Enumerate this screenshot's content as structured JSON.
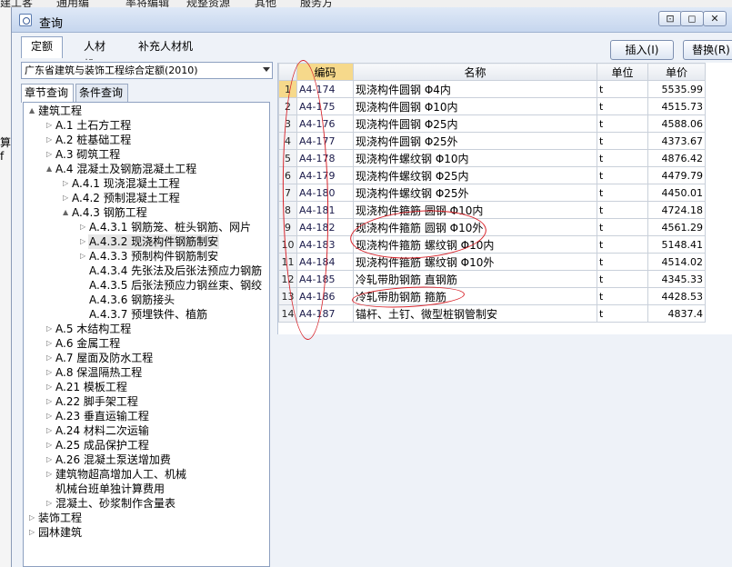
{
  "background_app": {
    "menu_items": [
      "建工客",
      "通用编",
      "率将编辑",
      "规整资源",
      "其他",
      "服务方"
    ],
    "left_text": "算f"
  },
  "dialog": {
    "title": "查询",
    "window_buttons": [
      "⊡",
      "◻",
      "✕"
    ],
    "top_tabs": [
      {
        "label": "定额",
        "active": true
      },
      {
        "label": "人材机",
        "active": false
      },
      {
        "label": "补充人材机",
        "active": false
      }
    ],
    "insert_button": "插入(I)",
    "replace_button": "替换(R)"
  },
  "left_panel": {
    "quota_library": "广东省建筑与装饰工程综合定额(2010)",
    "sub_tabs": [
      {
        "label": "章节查询",
        "active": true
      },
      {
        "label": "条件查询",
        "active": false
      }
    ],
    "tree": [
      {
        "label": "建筑工程",
        "level": 0,
        "toggle": "▲"
      },
      {
        "label": "A.1 土石方工程",
        "level": 1,
        "toggle": "▷"
      },
      {
        "label": "A.2 桩基础工程",
        "level": 1,
        "toggle": "▷"
      },
      {
        "label": "A.3 砌筑工程",
        "level": 1,
        "toggle": "▷"
      },
      {
        "label": "A.4 混凝土及钢筋混凝土工程",
        "level": 1,
        "toggle": "▲"
      },
      {
        "label": "A.4.1 现浇混凝土工程",
        "level": 2,
        "toggle": "▷"
      },
      {
        "label": "A.4.2 预制混凝土工程",
        "level": 2,
        "toggle": "▷"
      },
      {
        "label": "A.4.3 钢筋工程",
        "level": 2,
        "toggle": "▲"
      },
      {
        "label": "A.4.3.1 钢筋笼、桩头钢筋、网片",
        "level": 3,
        "toggle": "▷"
      },
      {
        "label": "A.4.3.2 现浇构件钢筋制安",
        "level": 3,
        "toggle": "▷",
        "selected": true
      },
      {
        "label": "A.4.3.3 预制构件钢筋制安",
        "level": 3,
        "toggle": "▷"
      },
      {
        "label": "A.4.3.4 先张法及后张法预应力钢筋",
        "level": 3,
        "toggle": ""
      },
      {
        "label": "A.4.3.5 后张法预应力钢丝束、钢绞",
        "level": 3,
        "toggle": ""
      },
      {
        "label": "A.4.3.6 钢筋接头",
        "level": 3,
        "toggle": ""
      },
      {
        "label": "A.4.3.7 预埋铁件、植筋",
        "level": 3,
        "toggle": ""
      },
      {
        "label": "A.5 木结构工程",
        "level": 1,
        "toggle": "▷"
      },
      {
        "label": "A.6 金属工程",
        "level": 1,
        "toggle": "▷"
      },
      {
        "label": "A.7 屋面及防水工程",
        "level": 1,
        "toggle": "▷"
      },
      {
        "label": "A.8 保温隔热工程",
        "level": 1,
        "toggle": "▷"
      },
      {
        "label": "A.21 模板工程",
        "level": 1,
        "toggle": "▷"
      },
      {
        "label": "A.22 脚手架工程",
        "level": 1,
        "toggle": "▷"
      },
      {
        "label": "A.23 垂直运输工程",
        "level": 1,
        "toggle": "▷"
      },
      {
        "label": "A.24 材料二次运输",
        "level": 1,
        "toggle": "▷"
      },
      {
        "label": "A.25 成品保护工程",
        "level": 1,
        "toggle": "▷"
      },
      {
        "label": "A.26 混凝土泵送增加费",
        "level": 1,
        "toggle": "▷"
      },
      {
        "label": "建筑物超高增加人工、机械",
        "level": 1,
        "toggle": "▷"
      },
      {
        "label": "机械台班单独计算费用",
        "level": 1,
        "toggle": ""
      },
      {
        "label": "混凝土、砂浆制作含量表",
        "level": 1,
        "toggle": "▷"
      },
      {
        "label": "装饰工程",
        "level": 0,
        "toggle": "▷"
      },
      {
        "label": "园林建筑",
        "level": 0,
        "toggle": "▷"
      }
    ]
  },
  "grid": {
    "columns": [
      "",
      "编码",
      "名称",
      "单位",
      "单价"
    ],
    "rows": [
      {
        "num": "1",
        "code": "A4-174",
        "name": "现浇构件圆钢 Φ4内",
        "unit": "t",
        "price": "5535.99"
      },
      {
        "num": "2",
        "code": "A4-175",
        "name": "现浇构件圆钢 Φ10内",
        "unit": "t",
        "price": "4515.73"
      },
      {
        "num": "3",
        "code": "A4-176",
        "name": "现浇构件圆钢 Φ25内",
        "unit": "t",
        "price": "4588.06"
      },
      {
        "num": "4",
        "code": "A4-177",
        "name": "现浇构件圆钢 Φ25外",
        "unit": "t",
        "price": "4373.67"
      },
      {
        "num": "5",
        "code": "A4-178",
        "name": "现浇构件螺纹钢 Φ10内",
        "unit": "t",
        "price": "4876.42"
      },
      {
        "num": "6",
        "code": "A4-179",
        "name": "现浇构件螺纹钢 Φ25内",
        "unit": "t",
        "price": "4479.79"
      },
      {
        "num": "7",
        "code": "A4-180",
        "name": "现浇构件螺纹钢 Φ25外",
        "unit": "t",
        "price": "4450.01"
      },
      {
        "num": "8",
        "code": "A4-181",
        "name": "现浇构件箍筋 圆钢 Φ10内",
        "unit": "t",
        "price": "4724.18"
      },
      {
        "num": "9",
        "code": "A4-182",
        "name": "现浇构件箍筋 圆钢 Φ10外",
        "unit": "t",
        "price": "4561.29"
      },
      {
        "num": "10",
        "code": "A4-183",
        "name": "现浇构件箍筋 螺纹钢 Φ10内",
        "unit": "t",
        "price": "5148.41"
      },
      {
        "num": "11",
        "code": "A4-184",
        "name": "现浇构件箍筋 螺纹钢 Φ10外",
        "unit": "t",
        "price": "4514.02"
      },
      {
        "num": "12",
        "code": "A4-185",
        "name": "冷轧带肋钢筋 直钢筋",
        "unit": "t",
        "price": "4345.33"
      },
      {
        "num": "13",
        "code": "A4-186",
        "name": "冷轧带肋钢筋 箍筋",
        "unit": "t",
        "price": "4428.53"
      },
      {
        "num": "14",
        "code": "A4-187",
        "name": "锚杆、土钉、微型桩钢管制安",
        "unit": "t",
        "price": "4837.4"
      }
    ]
  },
  "colors": {
    "highlight_header": "#f6d98b",
    "annotation_red": "#d8232a",
    "dialog_bg": "#eef2f8"
  }
}
